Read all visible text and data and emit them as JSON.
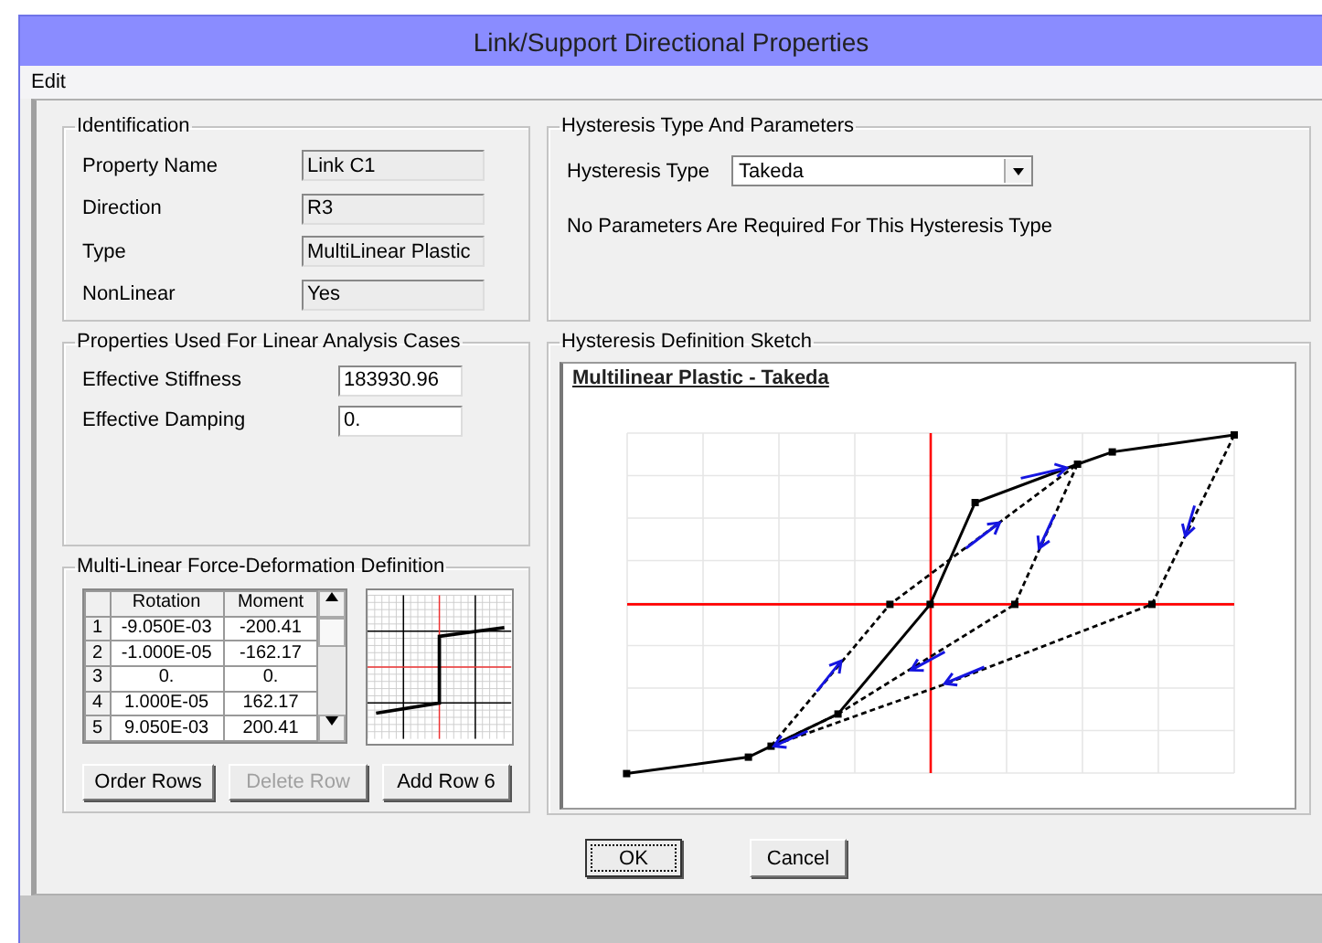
{
  "window": {
    "title": "Link/Support Directional Properties"
  },
  "menu": [
    {
      "label": "Edit"
    }
  ],
  "identification": {
    "title": "Identification",
    "fields": [
      {
        "label": "Property Name",
        "value": "Link C1",
        "readonly": true
      },
      {
        "label": "Direction",
        "value": "R3",
        "readonly": true
      },
      {
        "label": "Type",
        "value": "MultiLinear Plastic",
        "readonly": true
      },
      {
        "label": "NonLinear",
        "value": "Yes",
        "readonly": true
      }
    ]
  },
  "linear": {
    "title": "Properties Used For Linear Analysis Cases",
    "fields": [
      {
        "label": "Effective Stiffness",
        "value": "183930.96",
        "readonly": false
      },
      {
        "label": "Effective Damping",
        "value": "0.",
        "readonly": false
      }
    ]
  },
  "multilinear": {
    "title": "Multi-Linear Force-Deformation Definition",
    "table": {
      "columns": [
        "Rotation",
        "Moment"
      ],
      "rows": [
        {
          "index": "1",
          "cells": [
            "-9.050E-03",
            "-200.41"
          ]
        },
        {
          "index": "2",
          "cells": [
            "-1.000E-05",
            "-162.17"
          ]
        },
        {
          "index": "3",
          "cells": [
            "0.",
            "0."
          ]
        },
        {
          "index": "4",
          "cells": [
            "1.000E-05",
            "162.17"
          ]
        },
        {
          "index": "5",
          "cells": [
            "9.050E-03",
            "200.41"
          ]
        }
      ]
    },
    "buttons": [
      {
        "label": "Order Rows",
        "disabled": false
      },
      {
        "label": "Delete Row",
        "disabled": true
      },
      {
        "label": "Add Row 6",
        "disabled": false
      }
    ]
  },
  "hysteresis": {
    "title": "Hysteresis Type And Parameters",
    "type_label": "Hysteresis Type",
    "type_value": "Takeda",
    "note": "No Parameters Are Required For This Hysteresis Type"
  },
  "sketch": {
    "title": "Hysteresis Definition Sketch",
    "heading": "Multilinear Plastic - Takeda"
  },
  "buttons": [
    {
      "label": "OK",
      "focused": true
    },
    {
      "label": "Cancel",
      "focused": false
    }
  ]
}
